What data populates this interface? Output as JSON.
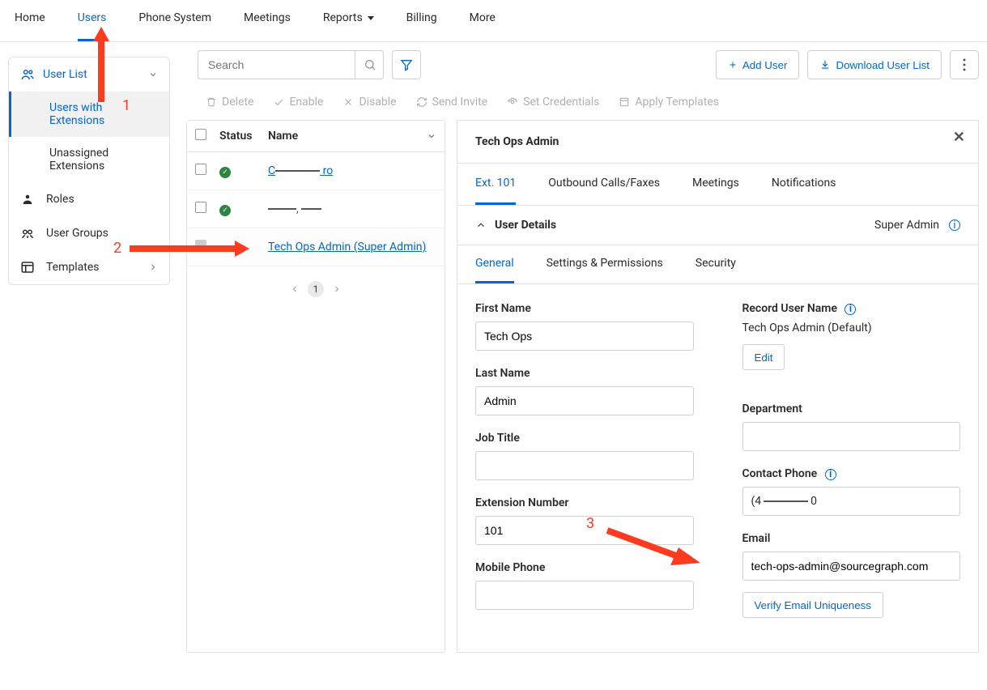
{
  "nav": {
    "home": "Home",
    "users": "Users",
    "phone_system": "Phone System",
    "meetings": "Meetings",
    "reports": "Reports",
    "billing": "Billing",
    "more": "More"
  },
  "sidebar": {
    "user_list": "User List",
    "users_with_ext": "Users with Extensions",
    "unassigned_ext": "Unassigned Extensions",
    "roles": "Roles",
    "user_groups": "User Groups",
    "templates": "Templates"
  },
  "toolbar": {
    "search_placeholder": "Search",
    "add_user": "Add User",
    "download_user_list": "Download User List"
  },
  "actions": {
    "delete": "Delete",
    "enable": "Enable",
    "disable": "Disable",
    "send_invite": "Send Invite",
    "set_credentials": "Set Credentials",
    "apply_templates": "Apply Templates"
  },
  "list": {
    "col_status": "Status",
    "col_name": "Name",
    "rows": [
      {
        "name_prefix": "C",
        "name_suffix": " ro"
      },
      {
        "name_prefix": "",
        "name_suffix": ""
      },
      {
        "name": "Tech Ops Admin (Super Admin)"
      }
    ],
    "page_current": "1"
  },
  "detail": {
    "title": "Tech Ops Admin",
    "tabs": {
      "ext": "Ext. 101",
      "outbound": "Outbound Calls/Faxes",
      "meetings": "Meetings",
      "notifications": "Notifications"
    },
    "section": "User Details",
    "role": "Super Admin",
    "subtabs": {
      "general": "General",
      "settings": "Settings & Permissions",
      "security": "Security"
    },
    "fields": {
      "first_name_label": "First Name",
      "first_name": "Tech Ops",
      "last_name_label": "Last Name",
      "last_name": "Admin",
      "job_title_label": "Job Title",
      "job_title": "",
      "extension_label": "Extension Number",
      "extension": "101",
      "mobile_label": "Mobile Phone",
      "mobile": "",
      "record_name_label": "Record User Name",
      "record_name_value": "Tech Ops Admin (Default)",
      "edit": "Edit",
      "department_label": "Department",
      "department": "",
      "contact_phone_label": "Contact Phone",
      "contact_phone_lparen": "(",
      "contact_phone_prefix": "4",
      "contact_phone_suffix": " 0",
      "email_label": "Email",
      "email": "tech-ops-admin@sourcegraph.com",
      "verify_email": "Verify Email Uniqueness"
    }
  },
  "annotations": {
    "one": "1",
    "two": "2",
    "three": "3"
  }
}
